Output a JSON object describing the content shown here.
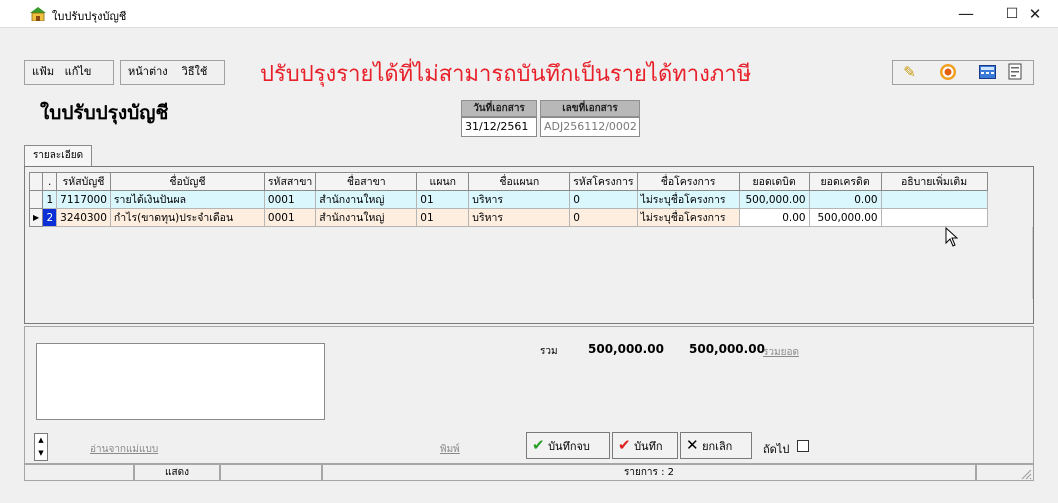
{
  "window": {
    "title": "ใบปรับปรุงบัญชี",
    "controls": [
      "—",
      "☐",
      "✕"
    ]
  },
  "menu": {
    "group1": [
      "แฟ้ม",
      "แก้ไข"
    ],
    "group2": [
      "หน้าต่าง",
      "วิธีใช้"
    ]
  },
  "banner_text": "ปรับปรุงรายได้ที่ไม่สามารถบันทึกเป็นรายได้ทางภาษี",
  "toolbar_icons": [
    "pen-icon",
    "target-icon",
    "calculator-icon",
    "document-icon"
  ],
  "document": {
    "title": "ใบปรับปรุงบัญชี",
    "date_label": "วันที่เอกสาร",
    "date_value": "31/12/2561",
    "number_label": "เลขที่เอกสาร",
    "number_value": "ADJ256112/0002"
  },
  "tab": "รายละเอียด",
  "grid": {
    "columns": [
      ".",
      "รหัสบัญชี",
      "ชื่อบัญชี",
      "รหัสสาขา",
      "ชื่อสาขา",
      "แผนก",
      "ชื่อแผนก",
      "รหัสโครงการ",
      "ชื่อโครงการ",
      "ยอดเดบิต",
      "ยอดเครดิต",
      "อธิบายเพิ่มเติม"
    ],
    "rows": [
      {
        "no": "1",
        "account_code": "7117000",
        "account_name": "รายได้เงินปันผล",
        "branch_code": "0001",
        "branch_name": "สำนักงานใหญ่",
        "dept": "01",
        "dept_name": "บริหาร",
        "project_code": "0",
        "project_name": "ไม่ระบุชื่อโครงการ",
        "debit": "500,000.00",
        "credit": "0.00",
        "note": ""
      },
      {
        "no": "2",
        "account_code": "3240300",
        "account_name": "กำไร(ขาดทุน)ประจำเดือน",
        "branch_code": "0001",
        "branch_name": "สำนักงานใหญ่",
        "dept": "01",
        "dept_name": "บริหาร",
        "project_code": "0",
        "project_name": "ไม่ระบุชื่อโครงการ",
        "debit": "0.00",
        "credit": "500,000.00",
        "note": ""
      }
    ]
  },
  "totals": {
    "label": "รวม",
    "debit": "500,000.00",
    "credit": "500,000.00",
    "link": "รวมยอด"
  },
  "bottom": {
    "read_template_link": "อ่านจากแม่แบบ",
    "print_link": "พิมพ์",
    "save_close_label": "บันทึกจบ",
    "save_label": "บันทึก",
    "cancel_label": "ยกเลิก",
    "next_label": "ถัดไป"
  },
  "status": {
    "show": "แสดง",
    "items": "รายการ : 2"
  },
  "colors": {
    "banner": "#e8202a",
    "row1": "#d9f7fc",
    "row2": "#fdeedf",
    "selected_row_number": "#0b2fd6"
  }
}
